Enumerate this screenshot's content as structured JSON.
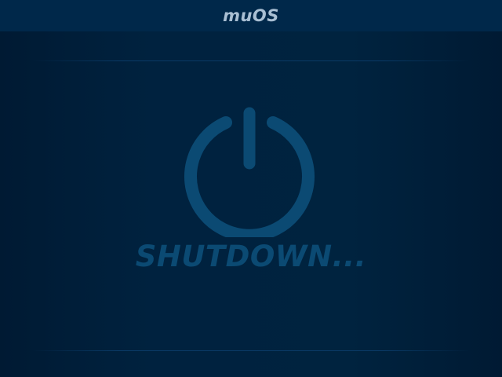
{
  "header": {
    "title": "muOS"
  },
  "status": {
    "text": "SHUTDOWN..."
  },
  "icons": {
    "main": "power-icon"
  },
  "colors": {
    "background": "#001d37",
    "header": "#00284a",
    "title": "#a9bfd3",
    "accent": "#0b4a73"
  }
}
